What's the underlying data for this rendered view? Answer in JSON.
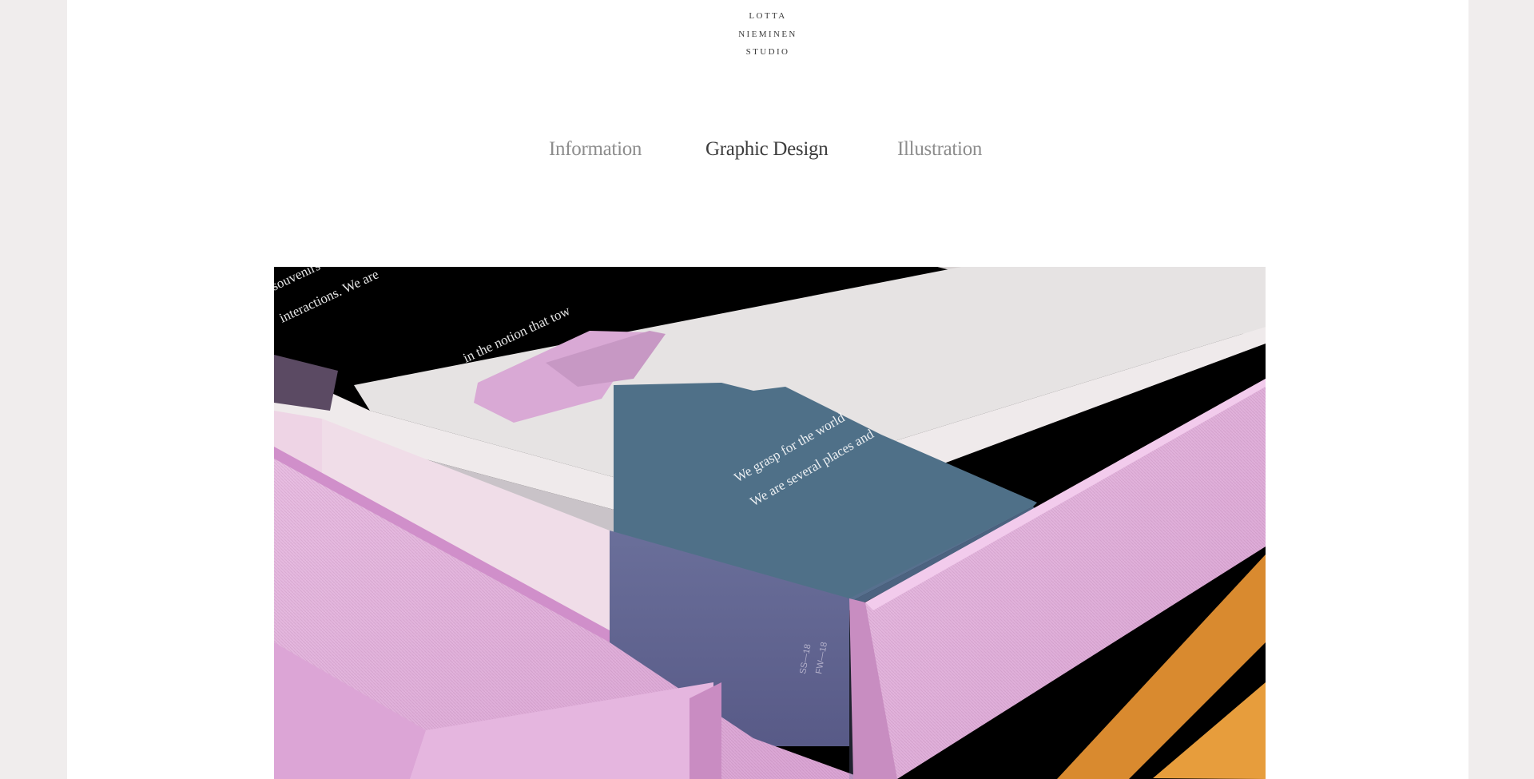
{
  "logo": {
    "line1": "LOTTA",
    "line2": "NIEMINEN",
    "line3": "STUDIO"
  },
  "nav": {
    "items": [
      {
        "label": "Information",
        "active": false
      },
      {
        "label": "Graphic Design",
        "active": true
      },
      {
        "label": "Illustration",
        "active": false
      }
    ]
  },
  "hero": {
    "spine_text": [
      "SS—18",
      "FW—18"
    ],
    "colors": {
      "background": "#000000",
      "pink_fabric": "#e3b3dd",
      "blue_paper": "#4f7088",
      "orange_fabric": "#e79d3c",
      "white_page": "#e7e4e4"
    }
  }
}
